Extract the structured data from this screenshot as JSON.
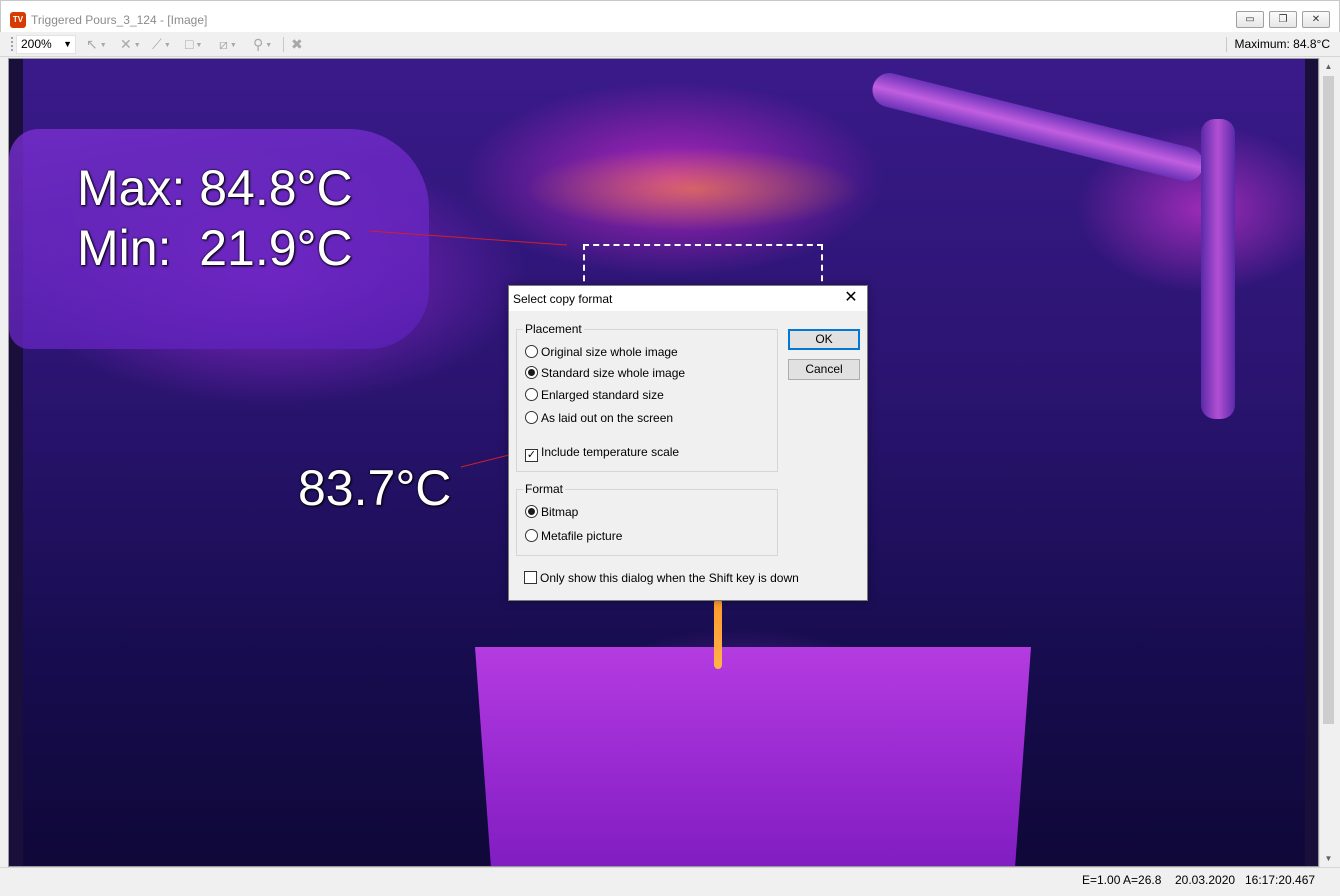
{
  "window": {
    "app_icon_text": "TV",
    "title": "Triggered Pours_3_124 - [Image]",
    "minimize_glyph": "▭",
    "restore_glyph": "❐",
    "close_glyph": "✕"
  },
  "toolbar": {
    "zoom_value": "200%",
    "zoom_arrow": "▼",
    "maximum_readout": "Maximum: 84.8°C",
    "tools": [
      {
        "icon": "select-arrow-icon",
        "glyph": "↖"
      },
      {
        "icon": "spot-marker-icon",
        "glyph": "✕"
      },
      {
        "icon": "line-tool-icon",
        "glyph": "⟋"
      },
      {
        "icon": "rectangle-tool-icon",
        "glyph": "□"
      },
      {
        "icon": "ruler-tool-icon",
        "glyph": "⧄"
      },
      {
        "icon": "pin-tool-icon",
        "glyph": "⚲"
      },
      {
        "icon": "delete-tool-icon",
        "glyph": "✖"
      }
    ],
    "dropdown_glyph": "▼"
  },
  "image": {
    "max_label": "Max: 84.8°C",
    "min_label": "Min:  21.9°C",
    "spot_label": "83.7°C"
  },
  "scrollbar": {
    "up_glyph": "▲",
    "down_glyph": "▼"
  },
  "status": {
    "emissivity": "E=1.00 A=26.8",
    "date": "20.03.2020",
    "time": "16:17:20.467"
  },
  "dialog": {
    "title": "Select copy format",
    "close_glyph": "✕",
    "placement_label": "Placement",
    "placement_options": [
      {
        "label": "Original size whole image",
        "selected": false
      },
      {
        "label": "Standard size whole image",
        "selected": true
      },
      {
        "label": "Enlarged standard size",
        "selected": false
      },
      {
        "label": "As laid out on the screen",
        "selected": false
      }
    ],
    "include_scale_label": "Include temperature scale",
    "include_scale_checked": true,
    "format_label": "Format",
    "format_options": [
      {
        "label": "Bitmap",
        "selected": true
      },
      {
        "label": "Metafile picture",
        "selected": false
      }
    ],
    "shift_only_label": "Only show this dialog when the Shift key is down",
    "shift_only_checked": false,
    "ok_label": "OK",
    "cancel_label": "Cancel",
    "check_glyph": "✓"
  }
}
